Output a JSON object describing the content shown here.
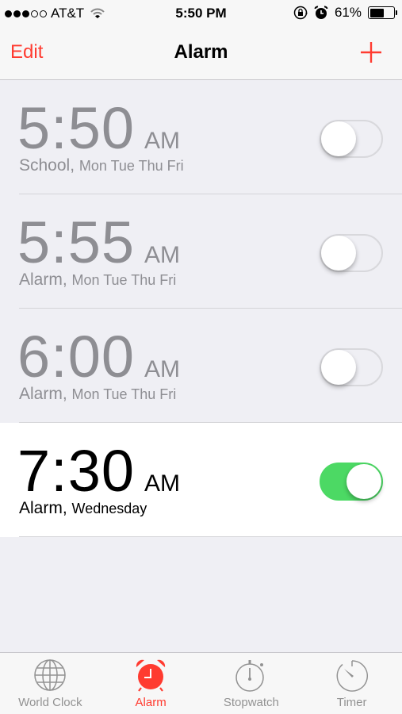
{
  "status_bar": {
    "signal_bars_filled": 3,
    "signal_bars_total": 5,
    "carrier": "AT&T",
    "time": "5:50 PM",
    "battery_percent_label": "61%",
    "battery_level": 0.61,
    "icons": [
      "wifi-icon",
      "rotation-lock-icon",
      "alarm-icon",
      "battery-icon"
    ]
  },
  "nav": {
    "edit_label": "Edit",
    "title": "Alarm",
    "add_icon": "plus-icon"
  },
  "alarms": [
    {
      "time": "5:50",
      "ampm": "AM",
      "label": "School,",
      "days": "Mon Tue Thu Fri",
      "enabled": false
    },
    {
      "time": "5:55",
      "ampm": "AM",
      "label": "Alarm,",
      "days": "Mon Tue Thu Fri",
      "enabled": false
    },
    {
      "time": "6:00",
      "ampm": "AM",
      "label": "Alarm,",
      "days": "Mon Tue Thu Fri",
      "enabled": false
    },
    {
      "time": "7:30",
      "ampm": "AM",
      "label": "Alarm,",
      "days": "Wednesday",
      "enabled": true
    }
  ],
  "tabs": [
    {
      "label": "World Clock",
      "icon": "globe-icon",
      "active": false
    },
    {
      "label": "Alarm",
      "icon": "alarm-clock-icon",
      "active": true
    },
    {
      "label": "Stopwatch",
      "icon": "stopwatch-icon",
      "active": false
    },
    {
      "label": "Timer",
      "icon": "timer-icon",
      "active": false
    }
  ],
  "colors": {
    "accent": "#ff3b30",
    "toggle_on": "#4cd964",
    "disabled_text": "#8e8e93",
    "inactive_tab": "#929292",
    "list_background": "#efeff4",
    "bar_background": "#f7f7f7"
  }
}
